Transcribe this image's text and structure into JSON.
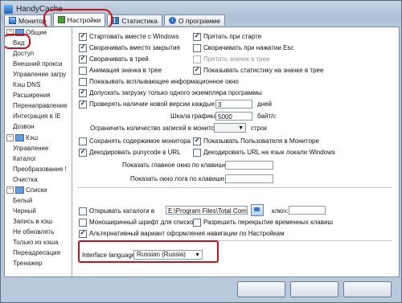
{
  "window": {
    "title": "HandyCache"
  },
  "tabs": [
    {
      "label": "Монитор"
    },
    {
      "label": "Настройки"
    },
    {
      "label": "Статистика"
    },
    {
      "label": "О программе"
    }
  ],
  "tree": {
    "items": [
      {
        "label": "Общие",
        "level": 0,
        "expand": "−"
      },
      {
        "label": "Вид",
        "level": 1
      },
      {
        "label": "Доступ",
        "level": 1
      },
      {
        "label": "Внешний прокси",
        "level": 1
      },
      {
        "label": "Управление загру",
        "level": 1
      },
      {
        "label": "Кэш DNS",
        "level": 1
      },
      {
        "label": "Расширения",
        "level": 1
      },
      {
        "label": "Перенаправление",
        "level": 1
      },
      {
        "label": "Интеграция в IE",
        "level": 1
      },
      {
        "label": "Дозвон",
        "level": 1
      },
      {
        "label": "Кэш",
        "level": 0,
        "expand": "−"
      },
      {
        "label": "Управление",
        "level": 1
      },
      {
        "label": "Каталог",
        "level": 1
      },
      {
        "label": "Преобразование !",
        "level": 1
      },
      {
        "label": "Очистка",
        "level": 1
      },
      {
        "label": "Списки",
        "level": 0,
        "expand": "−"
      },
      {
        "label": "Белый",
        "level": 1
      },
      {
        "label": "Черный",
        "level": 1
      },
      {
        "label": "Запись в кэш",
        "level": 1
      },
      {
        "label": "Не обновлять",
        "level": 1
      },
      {
        "label": "Только из кэша",
        "level": 1
      },
      {
        "label": "Переадресация",
        "level": 1
      },
      {
        "label": "Тренажер",
        "level": 1
      }
    ]
  },
  "options": {
    "start_with_windows": "Стартовать вместе с Windows",
    "hide_on_start": "Прятать при старте",
    "minimize_on_close": "Сворачивать вместо закрытия",
    "minimize_on_esc": "Сворачивать при нажатии Esc",
    "minimize_to_tray": "Сворачивать в трей",
    "hide_tray_icon": "Прятать значок в трее",
    "animate_tray_icon": "Анимация значка в трее",
    "show_tray_stats": "Показывать статистику на значке в трее",
    "show_popup": "Показывать всплывающее информационное окно",
    "single_instance": "Допускать загрузку только одного экземпляра программы",
    "check_new_version": "Проверять наличие новой версии каждые",
    "check_days_value": "3",
    "check_days_unit": "дней",
    "graph_scale_label": "Шкала графика:",
    "graph_scale_value": "5000",
    "graph_scale_unit": "байт/с",
    "limit_records_label": "Ограничить  количество  записей в мониторе",
    "limit_records_unit": "строк",
    "save_monitor": "Сохранять содержимое монитора",
    "show_users_monitor": "Показывать Пользователя в Мониторе",
    "decode_punycode": "Декодировать punycode в URL",
    "decode_url_locale": "Декодировать URL на язык локали Windows",
    "show_main_window_key": "Показать главное окно по клавише:",
    "show_log_window_key": "Показать окно лога по клавише:",
    "open_dirs_label": "Открывать каталоги в",
    "open_dirs_path": "E:\\Program Files\\Total Command",
    "keys_label": "ключ:",
    "monospace_font": "Моноширинный шрифт для списков",
    "allow_hotkey_override": "Разрешить перекрытие временных клавиш",
    "alt_nav_style": "Альтернативный вариант оформления навигации по Настройкам",
    "interface_language_label": "Interface language:",
    "interface_language_value": "Russian (Russia)"
  }
}
